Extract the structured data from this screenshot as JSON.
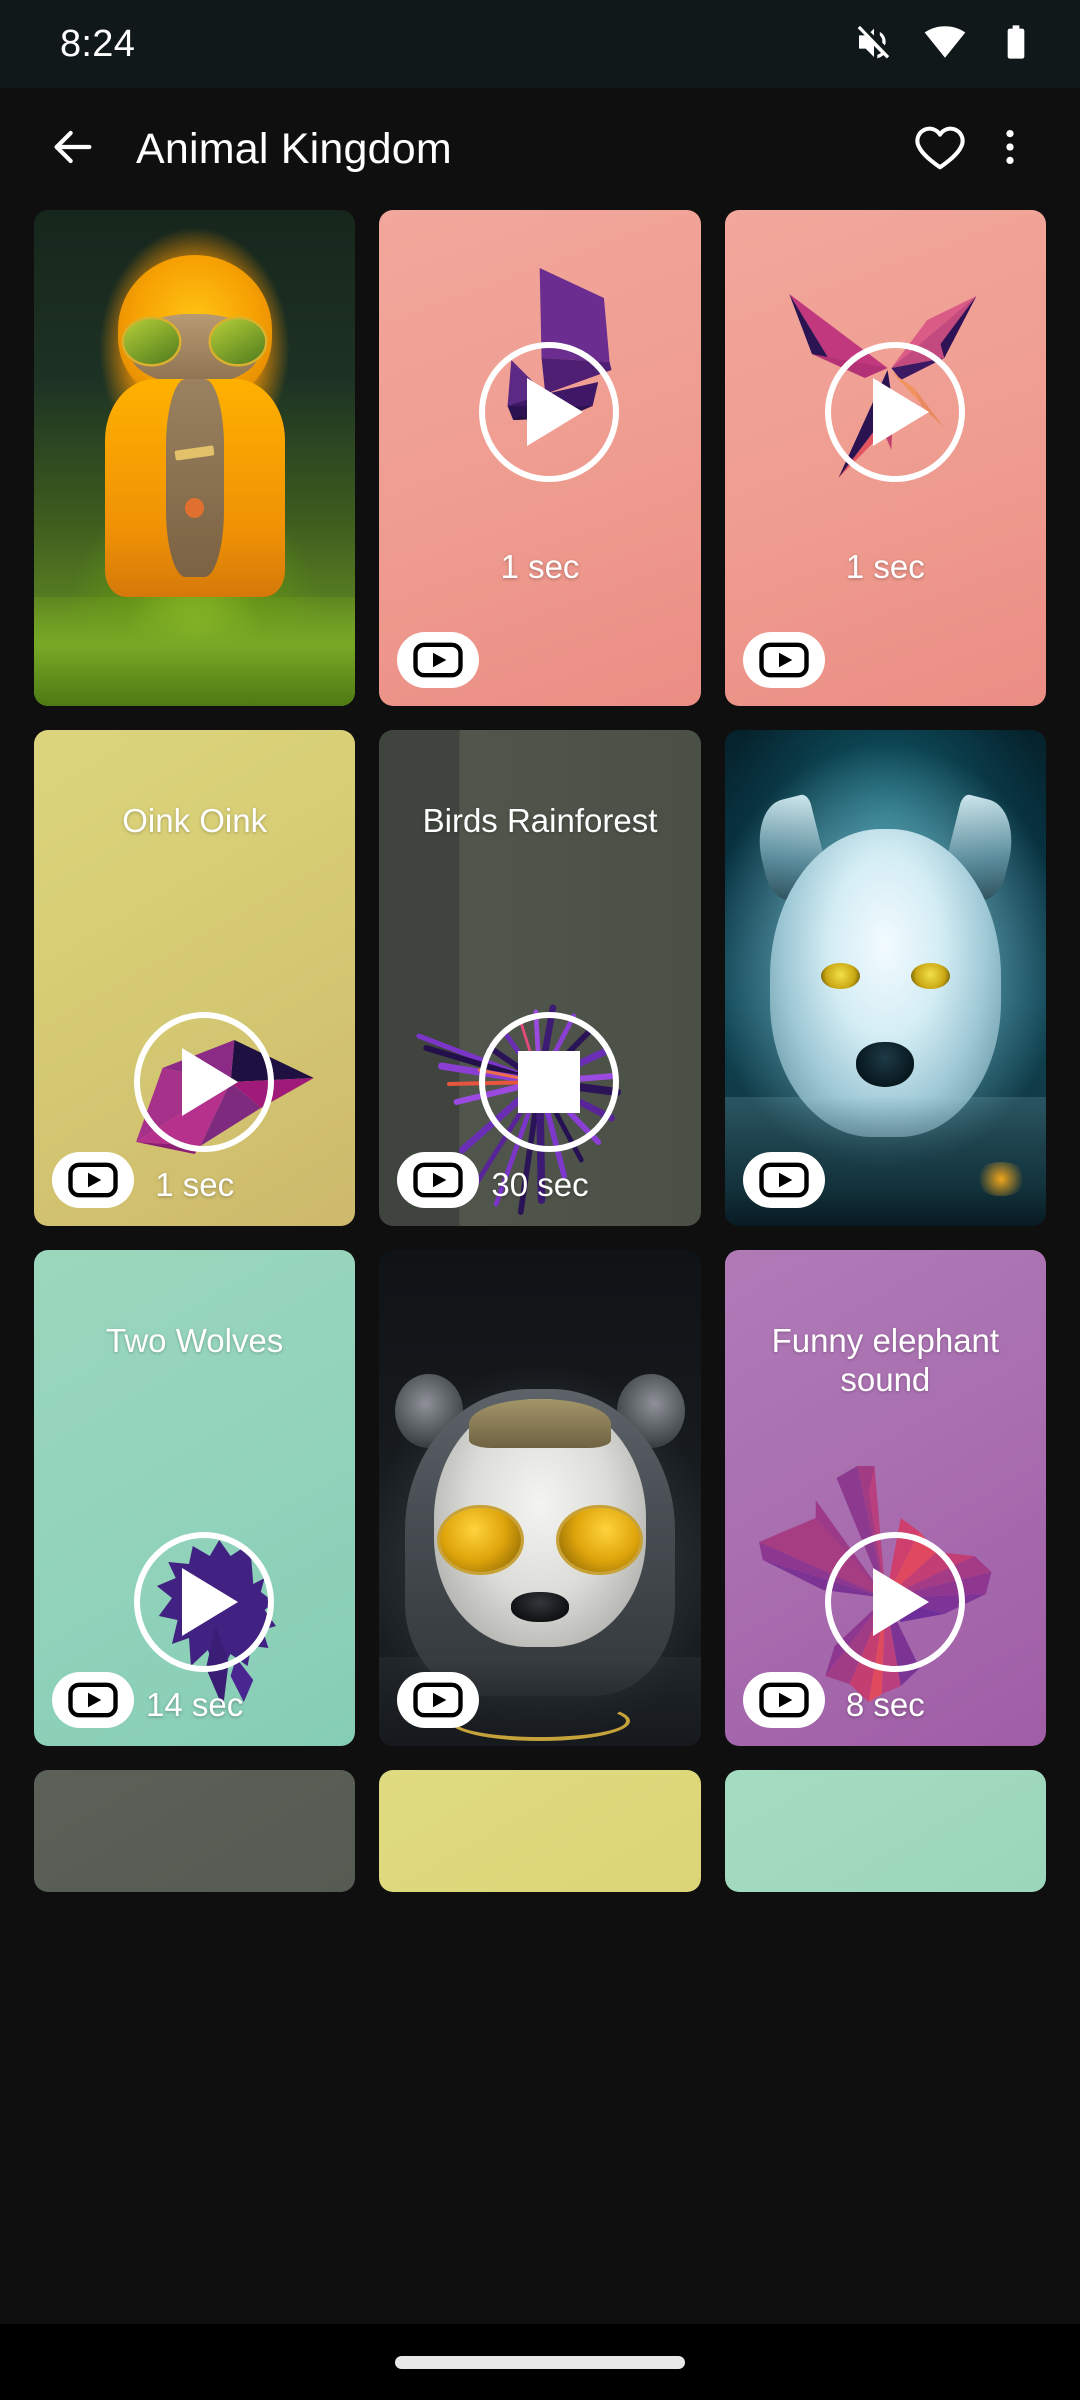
{
  "status_bar": {
    "clock": "8:24",
    "icons": [
      "volume-off-icon",
      "wifi-icon",
      "battery-icon"
    ]
  },
  "app_bar": {
    "back_icon": "arrow-back-icon",
    "title": "Animal Kingdom",
    "favorite_icon": "heart-outline-icon",
    "overflow_icon": "more-vertical-icon"
  },
  "grid": {
    "columns": 3,
    "badge_icon": "youtube-play-badge",
    "cards": [
      {
        "id": "card-1",
        "kind": "photo",
        "title": "",
        "duration": "",
        "state": "none",
        "badge": false,
        "art": "photo-rabbit-yellow-hoodie",
        "bg": "#1a2418"
      },
      {
        "id": "card-2",
        "kind": "art",
        "title": "",
        "duration": "1 sec",
        "state": "play",
        "badge": true,
        "art": "geometric-purple-block",
        "bg": "#f0a196"
      },
      {
        "id": "card-3",
        "kind": "art",
        "title": "",
        "duration": "1 sec",
        "state": "play",
        "badge": true,
        "art": "geometric-pink-star",
        "bg": "#f0a196"
      },
      {
        "id": "card-4",
        "kind": "art",
        "title": "Oink Oink",
        "duration": "1 sec",
        "state": "play",
        "badge": true,
        "art": "geometric-magenta-arrow",
        "bg": "#d9d177"
      },
      {
        "id": "card-5",
        "kind": "art",
        "title": "Birds Rainforest",
        "duration": "30 sec",
        "state": "stop",
        "badge": true,
        "art": "geometric-violet-burst",
        "bg": "#4a4f46"
      },
      {
        "id": "card-6",
        "kind": "photo",
        "title": "",
        "duration": "",
        "state": "none",
        "badge": true,
        "art": "photo-white-wolf",
        "bg": "#06222b"
      },
      {
        "id": "card-7",
        "kind": "art",
        "title": "Two Wolves",
        "duration": "14 sec",
        "state": "play",
        "badge": true,
        "art": "geometric-indigo-wolf",
        "bg": "#93d3bb"
      },
      {
        "id": "card-8",
        "kind": "photo",
        "title": "",
        "duration": "",
        "state": "none",
        "badge": true,
        "art": "photo-panda-gold-sunglasses",
        "bg": "#15181a"
      },
      {
        "id": "card-9",
        "kind": "art",
        "title": "Funny elephant sound",
        "duration": "8 sec",
        "state": "play",
        "badge": true,
        "art": "geometric-magenta-fan",
        "bg": "#ab6eb0"
      },
      {
        "id": "card-10",
        "kind": "partial",
        "title": "",
        "duration": "",
        "state": "none",
        "badge": false,
        "art": "",
        "bg": "#565c52"
      },
      {
        "id": "card-11",
        "kind": "partial",
        "title": "",
        "duration": "",
        "state": "none",
        "badge": false,
        "art": "",
        "bg": "#dbd877"
      },
      {
        "id": "card-12",
        "kind": "partial",
        "title": "",
        "duration": "",
        "state": "none",
        "badge": false,
        "art": "",
        "bg": "#9ed6b9"
      }
    ]
  },
  "nav_bar": {
    "home_indicator": "home-gesture-pill"
  },
  "colors": {
    "screen_bg": "#0f0f0f",
    "status_bg": "#111819",
    "salmon": "#f0a196",
    "khaki": "#d9d177",
    "olive_gray": "#4a4f46",
    "mint": "#93d3bb",
    "orchid": "#ab6eb0",
    "accent_white": "#ffffff"
  }
}
